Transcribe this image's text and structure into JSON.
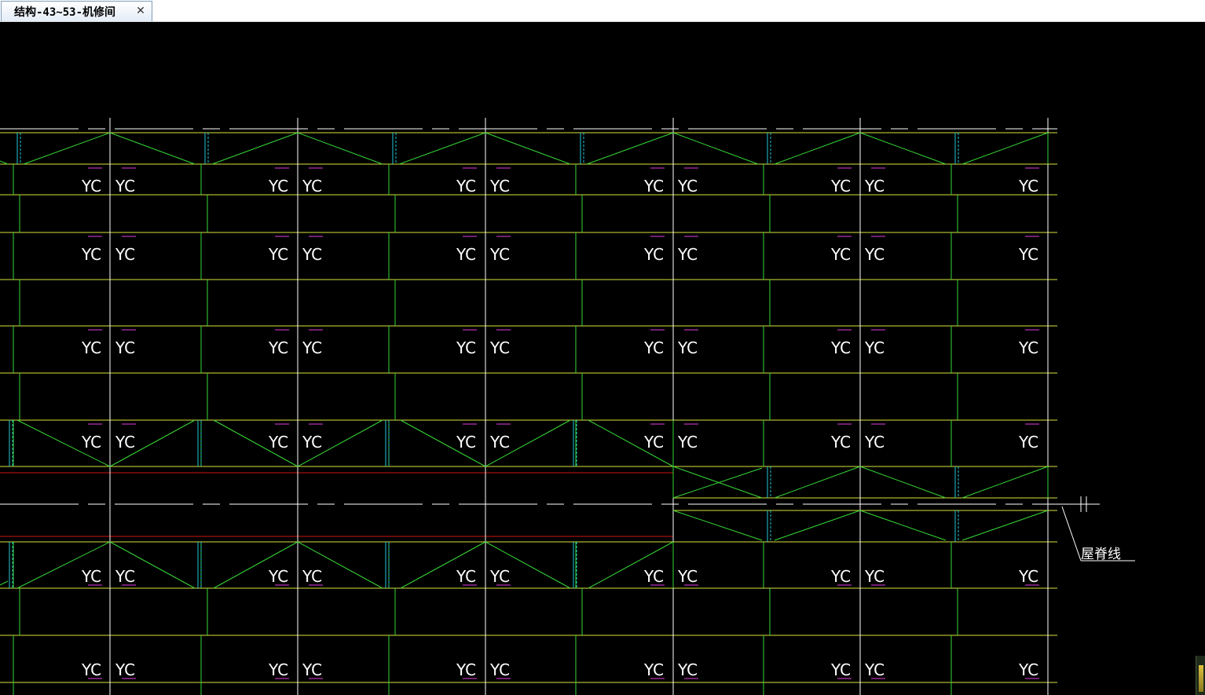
{
  "tab": {
    "title": "结构-43~53-机修间",
    "close_glyph": "✕"
  },
  "drawing": {
    "column_label": "YC",
    "annotation": "屋脊线",
    "colors": {
      "background": "#000000",
      "yellow": "#d8e43a",
      "green": "#36d836",
      "white": "#ffffff",
      "magenta": "#e040e0",
      "red": "#d21414",
      "cyan": "#20c8d8"
    }
  }
}
